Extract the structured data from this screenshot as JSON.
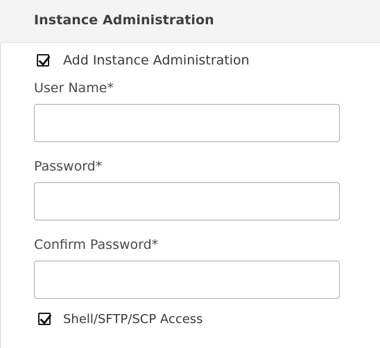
{
  "section": {
    "title": "Instance Administration"
  },
  "add_admin": {
    "label": "Add Instance Administration",
    "checked": true
  },
  "fields": {
    "username": {
      "label": "User Name*",
      "value": "",
      "placeholder": ""
    },
    "password": {
      "label": "Password*",
      "value": "",
      "placeholder": ""
    },
    "confirm_password": {
      "label": "Confirm Password*",
      "value": "",
      "placeholder": ""
    }
  },
  "shell_access": {
    "label": "Shell/SFTP/SCP Access",
    "checked": true
  },
  "icons": {
    "checkmark": "checkmark-icon"
  },
  "colors": {
    "header_bg": "#f4f4f5",
    "input_border": "#a9a9a9",
    "text": "#3a3a3a"
  }
}
